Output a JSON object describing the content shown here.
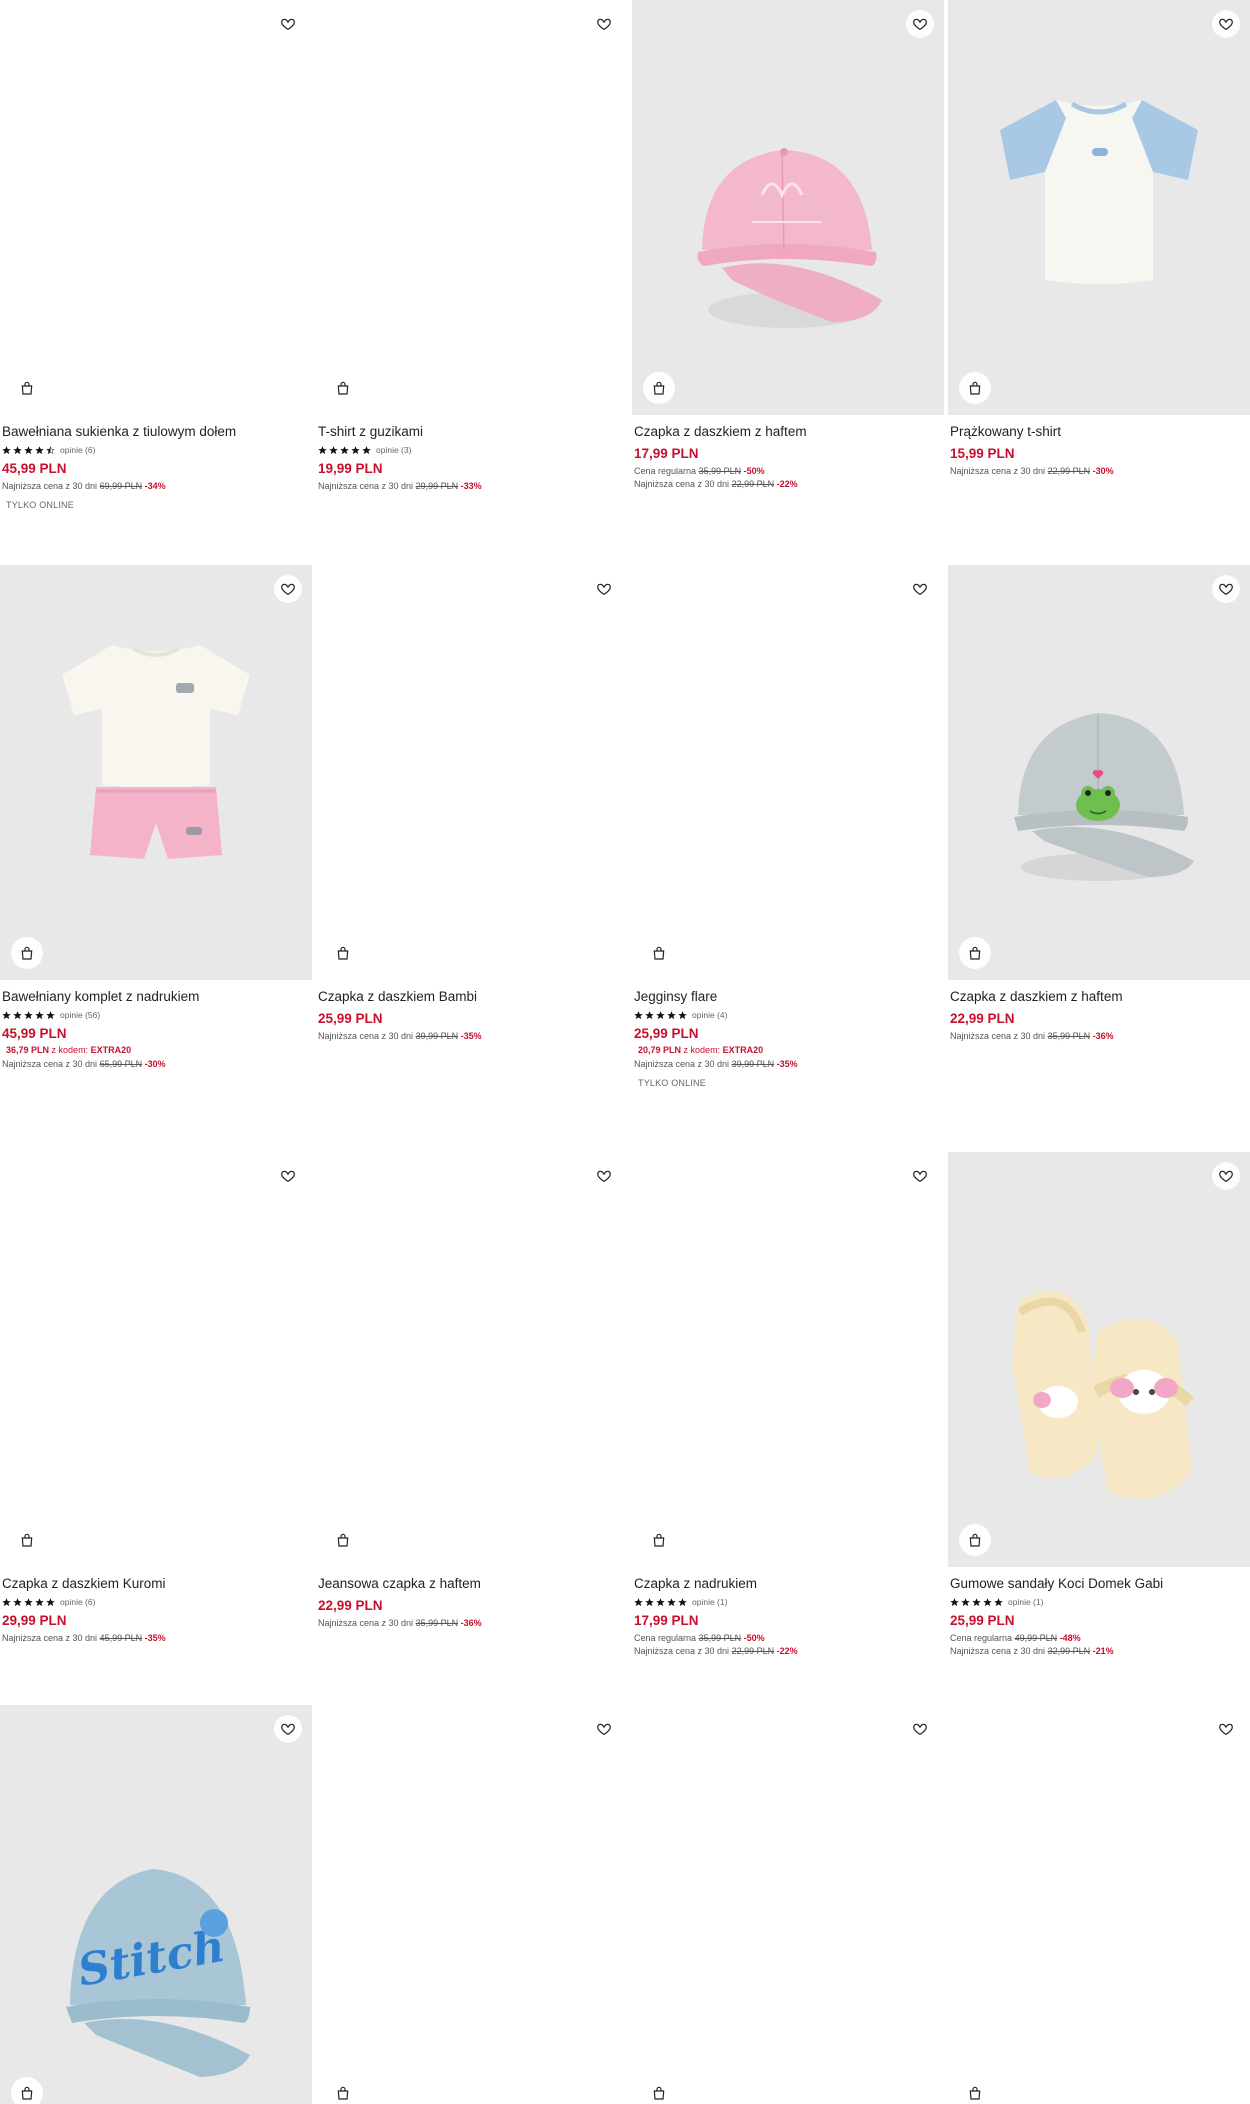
{
  "colors": {
    "accent": "#c8102e",
    "image_bg": "#e8e8e8",
    "text": "#222222"
  },
  "icons": {
    "wishlist": "heart-icon",
    "cart": "shopping-bag-icon",
    "rating": "star-icon"
  },
  "products": [
    {
      "name": "Bawełniana sukienka z tiulowym dołem",
      "rating": 4.5,
      "reviews": "opinie (6)",
      "price": "45,99 PLN",
      "lowest_label": "Najniższa cena z 30 dni",
      "lowest_price": "69,99 PLN",
      "lowest_discount": "-34%",
      "badge": "TYLKO ONLINE",
      "image": "none"
    },
    {
      "name": "T-shirt z guzikami",
      "rating": 5,
      "reviews": "opinie (3)",
      "price": "19,99 PLN",
      "lowest_label": "Najniższa cena z 30 dni",
      "lowest_price": "29,99 PLN",
      "lowest_discount": "-33%",
      "image": "none"
    },
    {
      "name": "Czapka z daszkiem z haftem",
      "price": "17,99 PLN",
      "regular_label": "Cena regularna",
      "regular_price": "35,99 PLN",
      "regular_discount": "-50%",
      "lowest_label": "Najniższa cena z 30 dni",
      "lowest_price": "22,99 PLN",
      "lowest_discount": "-22%",
      "image": "pink-cap"
    },
    {
      "name": "Prążkowany t-shirt",
      "price": "15,99 PLN",
      "lowest_label": "Najniższa cena z 30 dni",
      "lowest_price": "22,99 PLN",
      "lowest_discount": "-30%",
      "image": "raglan-tshirt"
    },
    {
      "name": "Bawełniany komplet z nadrukiem",
      "rating": 5,
      "reviews": "opinie (56)",
      "price": "45,99 PLN",
      "code_price": "36,79 PLN",
      "code_label": "z kodem:",
      "code": "EXTRA20",
      "lowest_label": "Najniższa cena z 30 dni",
      "lowest_price": "65,99 PLN",
      "lowest_discount": "-30%",
      "image": "set-shorts"
    },
    {
      "name": "Czapka z daszkiem Bambi",
      "price": "25,99 PLN",
      "lowest_label": "Najniższa cena z 30 dni",
      "lowest_price": "39,99 PLN",
      "lowest_discount": "-35%",
      "image": "none"
    },
    {
      "name": "Jegginsy flare",
      "rating": 5,
      "reviews": "opinie (4)",
      "price": "25,99 PLN",
      "code_price": "20,79 PLN",
      "code_label": "z kodem:",
      "code": "EXTRA20",
      "lowest_label": "Najniższa cena z 30 dni",
      "lowest_price": "39,99 PLN",
      "lowest_discount": "-35%",
      "badge": "TYLKO ONLINE",
      "image": "none"
    },
    {
      "name": "Czapka z daszkiem z haftem",
      "price": "22,99 PLN",
      "lowest_label": "Najniższa cena z 30 dni",
      "lowest_price": "35,99 PLN",
      "lowest_discount": "-36%",
      "image": "frog-cap"
    },
    {
      "name": "Czapka z daszkiem Kuromi",
      "rating": 5,
      "reviews": "opinie (6)",
      "price": "29,99 PLN",
      "lowest_label": "Najniższa cena z 30 dni",
      "lowest_price": "45,99 PLN",
      "lowest_discount": "-35%",
      "image": "none"
    },
    {
      "name": "Jeansowa czapka z haftem",
      "price": "22,99 PLN",
      "lowest_label": "Najniższa cena z 30 dni",
      "lowest_price": "35,99 PLN",
      "lowest_discount": "-36%",
      "image": "none"
    },
    {
      "name": "Czapka z nadrukiem",
      "rating": 5,
      "reviews": "opinie (1)",
      "price": "17,99 PLN",
      "regular_label": "Cena regularna",
      "regular_price": "35,99 PLN",
      "regular_discount": "-50%",
      "lowest_label": "Najniższa cena z 30 dni",
      "lowest_price": "22,99 PLN",
      "lowest_discount": "-22%",
      "image": "none"
    },
    {
      "name": "Gumowe sandały Koci Domek Gabi",
      "rating": 5,
      "reviews": "opinie (1)",
      "price": "25,99 PLN",
      "regular_label": "Cena regularna",
      "regular_price": "49,99 PLN",
      "regular_discount": "-48%",
      "lowest_label": "Najniższa cena z 30 dni",
      "lowest_price": "32,99 PLN",
      "lowest_discount": "-21%",
      "image": "sandals"
    },
    {
      "image": "stitch-cap",
      "image_text": "Stitch"
    },
    {
      "image": "none"
    },
    {
      "image": "none"
    },
    {
      "image": "none"
    }
  ]
}
